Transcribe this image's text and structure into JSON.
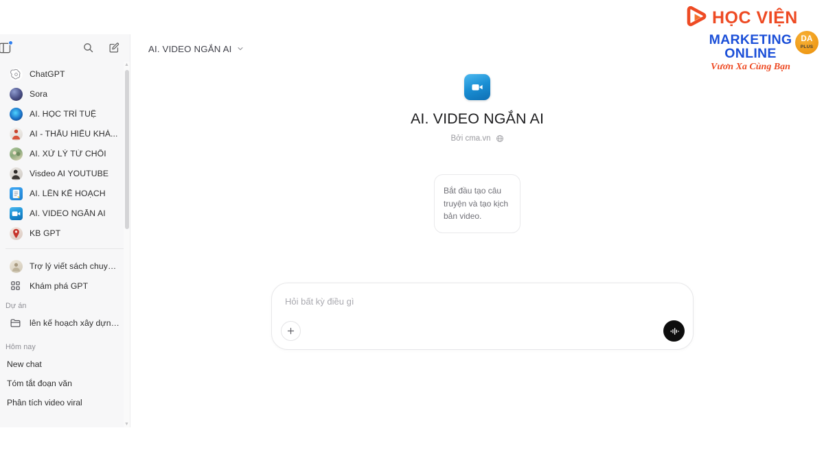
{
  "window": {
    "app_title": "ChatGPT"
  },
  "sidebar": {
    "toggle_icon": "sidebar-toggle-icon",
    "search_icon": "search-icon",
    "compose_icon": "compose-new-chat-icon",
    "gpts": [
      {
        "label": "ChatGPT",
        "icon": "chatgpt-logo-avatar"
      },
      {
        "label": "Sora",
        "icon": "sora-avatar"
      },
      {
        "label": "AI. HỌC TRÍ TUỆ",
        "icon": "brain-avatar"
      },
      {
        "label": "AI - THẤU HIỂU KHÁ...",
        "icon": "person-red-avatar"
      },
      {
        "label": "AI. XỬ LÝ TỪ CHỐI",
        "icon": "illustration-avatar"
      },
      {
        "label": "Visdeo AI YOUTUBE",
        "icon": "person-dark-avatar"
      },
      {
        "label": "AI. LÊN KẾ HOẠCH",
        "icon": "clipboard-avatar"
      },
      {
        "label": "AI. VIDEO NGẮN AI",
        "icon": "video-camera-avatar"
      },
      {
        "label": "KB GPT",
        "icon": "red-figure-avatar"
      }
    ],
    "secondary": [
      {
        "label": "Trợ lý viết sách chuyê...",
        "icon": "book-assistant-avatar"
      },
      {
        "label": "Khám phá GPT",
        "icon": "grid-apps-icon"
      }
    ],
    "projects": {
      "section_label": "Dự án",
      "items": [
        {
          "label": "lên kế hoạch xây dựng k...",
          "icon": "folder-icon"
        }
      ]
    },
    "history": {
      "section_label": "Hôm nay",
      "items": [
        {
          "label": "New chat"
        },
        {
          "label": "Tóm tắt đoạn văn"
        },
        {
          "label": "Phân tích video viral"
        }
      ]
    }
  },
  "header": {
    "gpt_name": "AI. VIDEO NGẮN AI",
    "chevron_icon": "chevron-down-icon"
  },
  "welcome": {
    "gpt_icon": "video-camera-icon",
    "gpt_name": "AI. VIDEO NGẮN AI",
    "byline": "Bởi cma.vn",
    "globe_icon": "globe-icon",
    "suggestions": [
      {
        "text": "Bắt đầu tạo câu truyện và tạo kịch bản video."
      }
    ]
  },
  "composer": {
    "placeholder": "Hỏi bất kỳ điều gì",
    "value": "",
    "attach_icon": "plus-icon",
    "voice_icon": "voice-waveform-icon"
  },
  "brand": {
    "play_icon": "play-logo-mark",
    "line1": "HỌC VIỆN",
    "line2": "MARKETING ONLINE",
    "slogan": "Vươn Xa Cùng Bạn",
    "badge_top": "DA",
    "badge_bottom": "PLUS"
  },
  "colors": {
    "sidebar_bg": "#f7f7f8",
    "brand_orange": "#ee4a23",
    "brand_blue": "#1b4fd8",
    "badge_gold": "#ef9a17",
    "gpt_icon_blue": "#1a8fd4",
    "notification_dot": "#2f7ff0"
  }
}
